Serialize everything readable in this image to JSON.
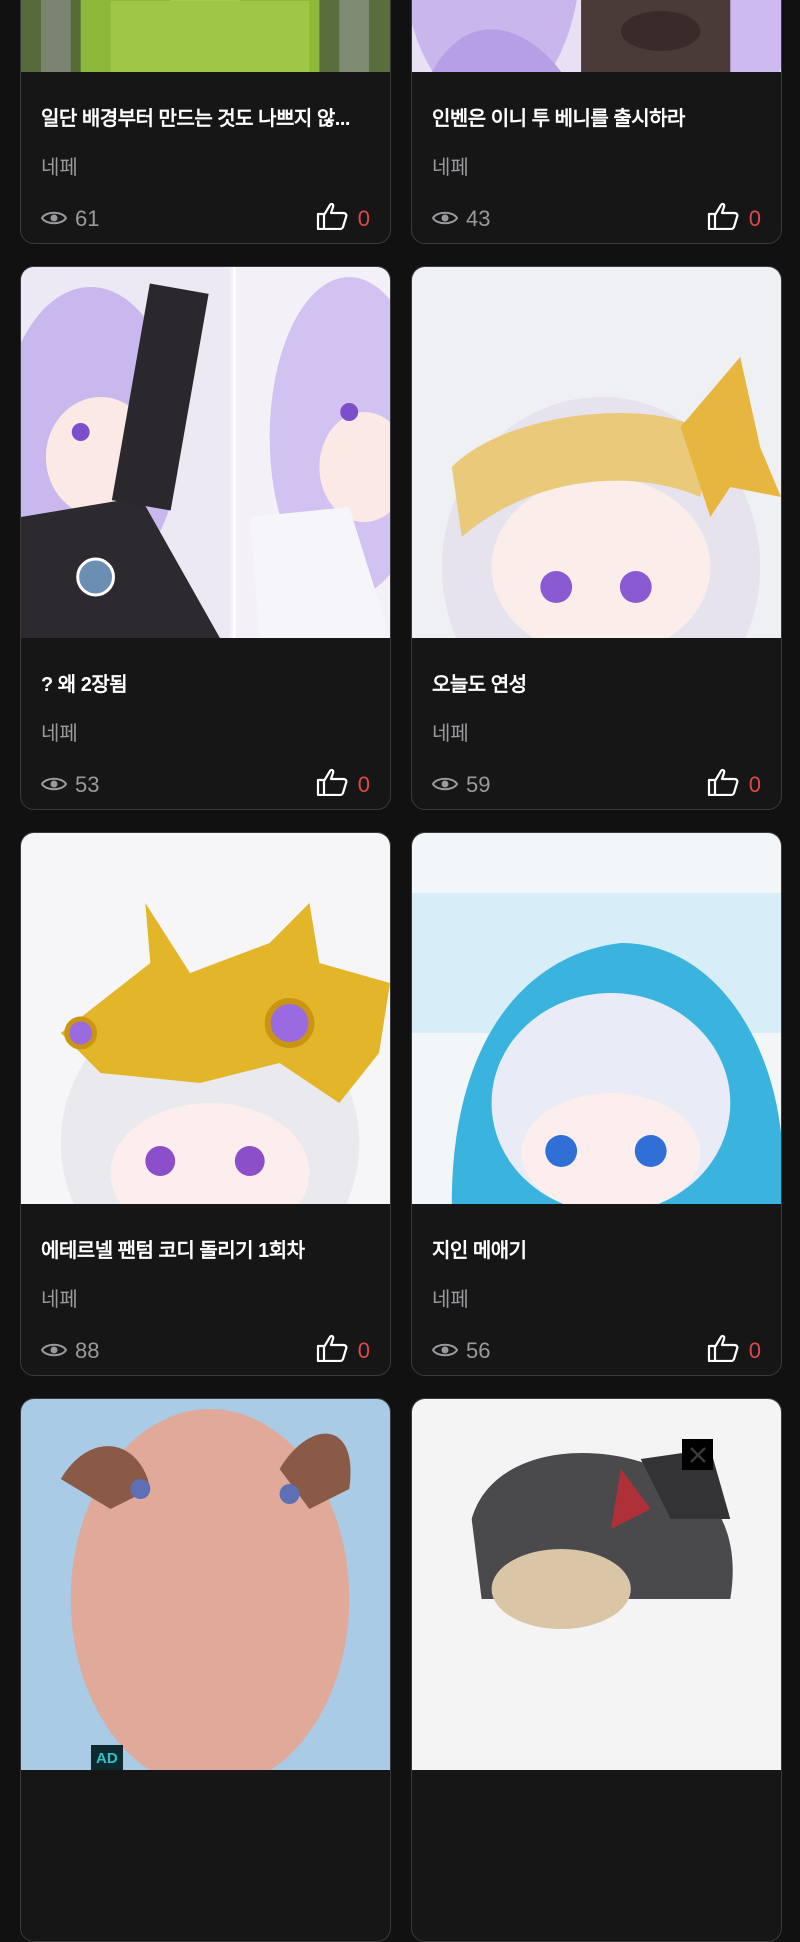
{
  "posts": [
    {
      "title": "일단 배경부터 만드는 것도 나쁘지 않...",
      "author": "네페",
      "views": "61",
      "likes": "0"
    },
    {
      "title": "인벤은 이니 투 베니를 출시하라",
      "author": "네페",
      "views": "43",
      "likes": "0"
    },
    {
      "title": "? 왜 2장됨",
      "author": "네페",
      "views": "53",
      "likes": "0"
    },
    {
      "title": "오늘도 연성",
      "author": "네페",
      "views": "59",
      "likes": "0"
    },
    {
      "title": "에테르넬 팬텀 코디 돌리기 1회차",
      "author": "네페",
      "views": "88",
      "likes": "0"
    },
    {
      "title": "지인 메애기",
      "author": "네페",
      "views": "56",
      "likes": "0"
    }
  ],
  "ad": {
    "badge": "AD"
  },
  "colors": {
    "background": "#111112",
    "like_count": "#e04848",
    "muted": "#9a9a9d",
    "ad_accent": "#2ec4c9"
  },
  "icons": [
    "eye-icon",
    "thumbs-up-icon",
    "close-icon"
  ]
}
